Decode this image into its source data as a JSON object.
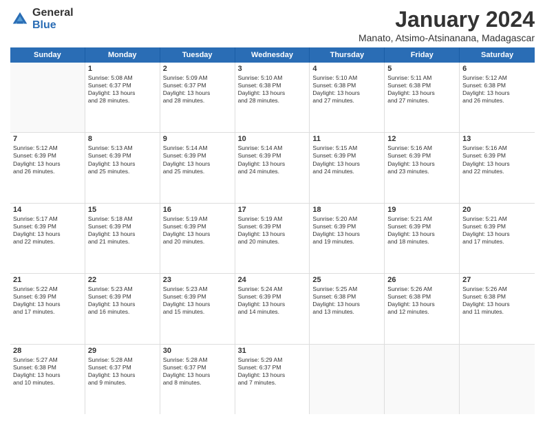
{
  "logo": {
    "general": "General",
    "blue": "Blue"
  },
  "title": "January 2024",
  "subtitle": "Manato, Atsimo-Atsinanana, Madagascar",
  "headers": [
    "Sunday",
    "Monday",
    "Tuesday",
    "Wednesday",
    "Thursday",
    "Friday",
    "Saturday"
  ],
  "weeks": [
    [
      {
        "day": "",
        "lines": []
      },
      {
        "day": "1",
        "lines": [
          "Sunrise: 5:08 AM",
          "Sunset: 6:37 PM",
          "Daylight: 13 hours",
          "and 28 minutes."
        ]
      },
      {
        "day": "2",
        "lines": [
          "Sunrise: 5:09 AM",
          "Sunset: 6:37 PM",
          "Daylight: 13 hours",
          "and 28 minutes."
        ]
      },
      {
        "day": "3",
        "lines": [
          "Sunrise: 5:10 AM",
          "Sunset: 6:38 PM",
          "Daylight: 13 hours",
          "and 28 minutes."
        ]
      },
      {
        "day": "4",
        "lines": [
          "Sunrise: 5:10 AM",
          "Sunset: 6:38 PM",
          "Daylight: 13 hours",
          "and 27 minutes."
        ]
      },
      {
        "day": "5",
        "lines": [
          "Sunrise: 5:11 AM",
          "Sunset: 6:38 PM",
          "Daylight: 13 hours",
          "and 27 minutes."
        ]
      },
      {
        "day": "6",
        "lines": [
          "Sunrise: 5:12 AM",
          "Sunset: 6:38 PM",
          "Daylight: 13 hours",
          "and 26 minutes."
        ]
      }
    ],
    [
      {
        "day": "7",
        "lines": [
          "Sunrise: 5:12 AM",
          "Sunset: 6:39 PM",
          "Daylight: 13 hours",
          "and 26 minutes."
        ]
      },
      {
        "day": "8",
        "lines": [
          "Sunrise: 5:13 AM",
          "Sunset: 6:39 PM",
          "Daylight: 13 hours",
          "and 25 minutes."
        ]
      },
      {
        "day": "9",
        "lines": [
          "Sunrise: 5:14 AM",
          "Sunset: 6:39 PM",
          "Daylight: 13 hours",
          "and 25 minutes."
        ]
      },
      {
        "day": "10",
        "lines": [
          "Sunrise: 5:14 AM",
          "Sunset: 6:39 PM",
          "Daylight: 13 hours",
          "and 24 minutes."
        ]
      },
      {
        "day": "11",
        "lines": [
          "Sunrise: 5:15 AM",
          "Sunset: 6:39 PM",
          "Daylight: 13 hours",
          "and 24 minutes."
        ]
      },
      {
        "day": "12",
        "lines": [
          "Sunrise: 5:16 AM",
          "Sunset: 6:39 PM",
          "Daylight: 13 hours",
          "and 23 minutes."
        ]
      },
      {
        "day": "13",
        "lines": [
          "Sunrise: 5:16 AM",
          "Sunset: 6:39 PM",
          "Daylight: 13 hours",
          "and 22 minutes."
        ]
      }
    ],
    [
      {
        "day": "14",
        "lines": [
          "Sunrise: 5:17 AM",
          "Sunset: 6:39 PM",
          "Daylight: 13 hours",
          "and 22 minutes."
        ]
      },
      {
        "day": "15",
        "lines": [
          "Sunrise: 5:18 AM",
          "Sunset: 6:39 PM",
          "Daylight: 13 hours",
          "and 21 minutes."
        ]
      },
      {
        "day": "16",
        "lines": [
          "Sunrise: 5:19 AM",
          "Sunset: 6:39 PM",
          "Daylight: 13 hours",
          "and 20 minutes."
        ]
      },
      {
        "day": "17",
        "lines": [
          "Sunrise: 5:19 AM",
          "Sunset: 6:39 PM",
          "Daylight: 13 hours",
          "and 20 minutes."
        ]
      },
      {
        "day": "18",
        "lines": [
          "Sunrise: 5:20 AM",
          "Sunset: 6:39 PM",
          "Daylight: 13 hours",
          "and 19 minutes."
        ]
      },
      {
        "day": "19",
        "lines": [
          "Sunrise: 5:21 AM",
          "Sunset: 6:39 PM",
          "Daylight: 13 hours",
          "and 18 minutes."
        ]
      },
      {
        "day": "20",
        "lines": [
          "Sunrise: 5:21 AM",
          "Sunset: 6:39 PM",
          "Daylight: 13 hours",
          "and 17 minutes."
        ]
      }
    ],
    [
      {
        "day": "21",
        "lines": [
          "Sunrise: 5:22 AM",
          "Sunset: 6:39 PM",
          "Daylight: 13 hours",
          "and 17 minutes."
        ]
      },
      {
        "day": "22",
        "lines": [
          "Sunrise: 5:23 AM",
          "Sunset: 6:39 PM",
          "Daylight: 13 hours",
          "and 16 minutes."
        ]
      },
      {
        "day": "23",
        "lines": [
          "Sunrise: 5:23 AM",
          "Sunset: 6:39 PM",
          "Daylight: 13 hours",
          "and 15 minutes."
        ]
      },
      {
        "day": "24",
        "lines": [
          "Sunrise: 5:24 AM",
          "Sunset: 6:39 PM",
          "Daylight: 13 hours",
          "and 14 minutes."
        ]
      },
      {
        "day": "25",
        "lines": [
          "Sunrise: 5:25 AM",
          "Sunset: 6:38 PM",
          "Daylight: 13 hours",
          "and 13 minutes."
        ]
      },
      {
        "day": "26",
        "lines": [
          "Sunrise: 5:26 AM",
          "Sunset: 6:38 PM",
          "Daylight: 13 hours",
          "and 12 minutes."
        ]
      },
      {
        "day": "27",
        "lines": [
          "Sunrise: 5:26 AM",
          "Sunset: 6:38 PM",
          "Daylight: 13 hours",
          "and 11 minutes."
        ]
      }
    ],
    [
      {
        "day": "28",
        "lines": [
          "Sunrise: 5:27 AM",
          "Sunset: 6:38 PM",
          "Daylight: 13 hours",
          "and 10 minutes."
        ]
      },
      {
        "day": "29",
        "lines": [
          "Sunrise: 5:28 AM",
          "Sunset: 6:37 PM",
          "Daylight: 13 hours",
          "and 9 minutes."
        ]
      },
      {
        "day": "30",
        "lines": [
          "Sunrise: 5:28 AM",
          "Sunset: 6:37 PM",
          "Daylight: 13 hours",
          "and 8 minutes."
        ]
      },
      {
        "day": "31",
        "lines": [
          "Sunrise: 5:29 AM",
          "Sunset: 6:37 PM",
          "Daylight: 13 hours",
          "and 7 minutes."
        ]
      },
      {
        "day": "",
        "lines": []
      },
      {
        "day": "",
        "lines": []
      },
      {
        "day": "",
        "lines": []
      }
    ]
  ]
}
